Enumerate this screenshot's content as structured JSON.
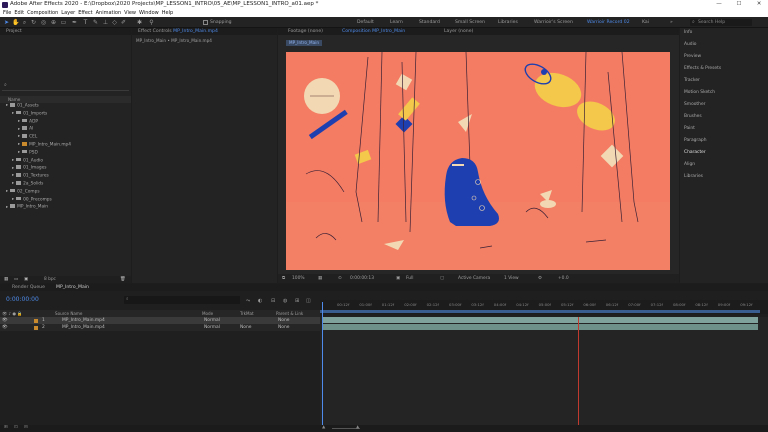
{
  "window": {
    "title": "Adobe After Effects 2020 - E:\\Dropbox\\2020 Projects\\MP_LESSON1_INTRO\\05_AE\\MP_LESSON1_INTRO_a01.aep *",
    "minimize": "—",
    "maximize": "☐",
    "close": "✕"
  },
  "menu": [
    "File",
    "Edit",
    "Composition",
    "Layer",
    "Effect",
    "Animation",
    "View",
    "Window",
    "Help"
  ],
  "toolbar": {
    "snapping_label": "Snapping",
    "workspaces": [
      "Default",
      "Learn",
      "Standard",
      "Small Screen",
      "Libraries",
      "Warrioir's Screen",
      "Warrioir Record 02",
      "Kai"
    ],
    "active_workspace_index": 6,
    "more": "»",
    "search_placeholder": "Search Help"
  },
  "project_panel": {
    "tab": "Project",
    "effect_controls_tab": "Effect Controls",
    "effect_controls_target": "MP_Intro_Main.mp4",
    "subtitle": "MP_Intro_Main • MP_Intro_Main.mp4",
    "column_name": "Name",
    "items": [
      {
        "indent": 0,
        "label": "01_Assets",
        "color": "gray"
      },
      {
        "indent": 1,
        "label": "01_Imports",
        "color": "gray"
      },
      {
        "indent": 2,
        "label": "ADP",
        "color": "gray"
      },
      {
        "indent": 2,
        "label": "AI",
        "color": "gray"
      },
      {
        "indent": 2,
        "label": "CEL",
        "color": "gray"
      },
      {
        "indent": 2,
        "label": "MP_Intro_Main.mp4",
        "color": "orange"
      },
      {
        "indent": 2,
        "label": "PSD",
        "color": "gray"
      },
      {
        "indent": 1,
        "label": "01_Audio",
        "color": "gray"
      },
      {
        "indent": 1,
        "label": "01_Images",
        "color": "gray"
      },
      {
        "indent": 1,
        "label": "01_Textures",
        "color": "gray"
      },
      {
        "indent": 1,
        "label": "2a_Solids",
        "color": "gray"
      },
      {
        "indent": 0,
        "label": "02_Comps",
        "color": "gray"
      },
      {
        "indent": 1,
        "label": "00_Precomps",
        "color": "gray"
      },
      {
        "indent": 0,
        "label": "MP_Intro_Main",
        "color": "gray"
      }
    ],
    "bpc": "8 bpc"
  },
  "viewer": {
    "tabs": [
      {
        "label": "Footage (none)",
        "active": false
      },
      {
        "label": "Composition MP_Intro_Main",
        "active": true
      },
      {
        "label": "Layer (none)",
        "active": false
      }
    ],
    "comp_chip": "MP_Intro_Main",
    "zoom": "100%",
    "timecode": "0:00:00:13",
    "resolution": "Full",
    "camera": "Active Camera",
    "views": "1 View",
    "exposure": "+0.0"
  },
  "right_panel": {
    "items": [
      "Info",
      "Audio",
      "Preview",
      "Effects & Presets",
      "Tracker",
      "Motion Sketch",
      "Smoother",
      "Brushes",
      "Paint",
      "Paragraph",
      "Character",
      "Align",
      "Libraries"
    ],
    "active_index": 10
  },
  "timeline": {
    "tabs": [
      {
        "label": "Render Queue",
        "active": false
      },
      {
        "label": "MP_Intro_Main",
        "active": true
      }
    ],
    "timecode": "0:00:00:00",
    "search_placeholder": "⌕",
    "columns": {
      "source_name": "Source Name",
      "mode": "Mode",
      "trkmat": "TrkMat",
      "parent": "Parent & Link"
    },
    "layers": [
      {
        "num": "1",
        "name": "MP_Intro_Main.mp4",
        "mode": "Normal",
        "trkmat": "",
        "parent": "None",
        "selected": true
      },
      {
        "num": "2",
        "name": "MP_Intro_Main.mp4",
        "mode": "Normal",
        "trkmat": "None",
        "parent": "None",
        "selected": false
      }
    ],
    "ruler": [
      "00:12f",
      "01:00f",
      "01:12f",
      "02:00f",
      "02:12f",
      "03:00f",
      "03:12f",
      "04:00f",
      "04:12f",
      "05:00f",
      "05:12f",
      "06:00f",
      "06:12f",
      "07:00f",
      "07:12f",
      "08:00f",
      "08:12f",
      "09:00f",
      "09:12f"
    ],
    "toggle_label": "Toggle Switches / Modes"
  },
  "colors": {
    "accent": "#4e8bea",
    "comp_bg": "#f47c63",
    "blob": "#1e3fb0",
    "track": "#7fa39c",
    "playhead": "#c03a30"
  }
}
